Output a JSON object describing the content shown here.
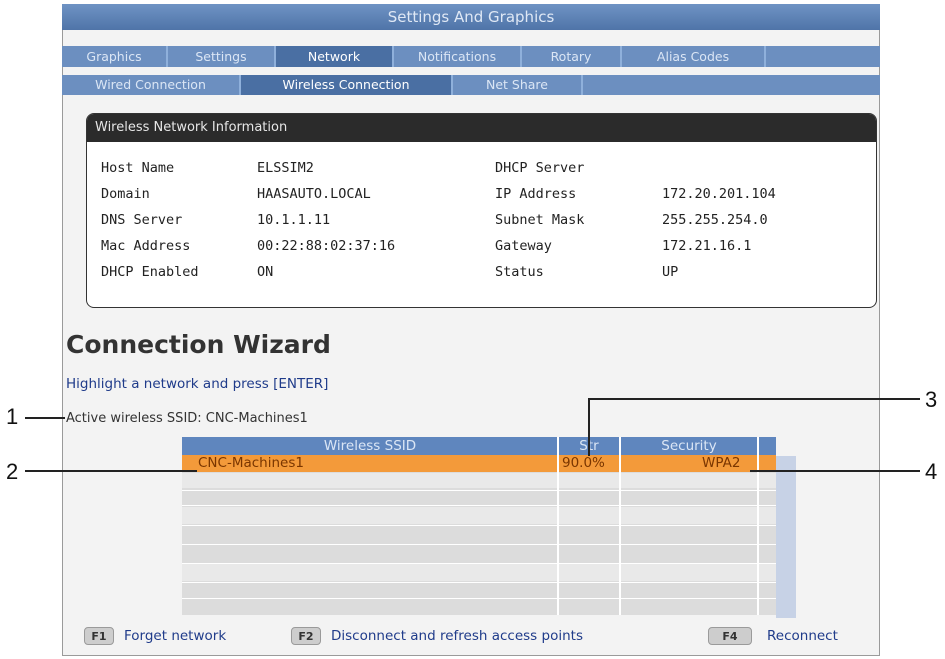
{
  "window": {
    "title": "Settings And Graphics"
  },
  "tabs_primary": [
    {
      "label": "Graphics"
    },
    {
      "label": "Settings"
    },
    {
      "label": "Network",
      "active": true
    },
    {
      "label": "Notifications"
    },
    {
      "label": "Rotary"
    },
    {
      "label": "Alias Codes"
    }
  ],
  "tabs_secondary": [
    {
      "label": "Wired Connection"
    },
    {
      "label": "Wireless Connection",
      "active": true
    },
    {
      "label": "Net Share"
    }
  ],
  "info_panel": {
    "title": "Wireless Network Information",
    "left": [
      {
        "label": "Host Name",
        "value": "ELSSIM2"
      },
      {
        "label": "Domain",
        "value": "HAASAUTO.LOCAL"
      },
      {
        "label": "DNS Server",
        "value": "10.1.1.11"
      },
      {
        "label": "Mac Address",
        "value": "00:22:88:02:37:16"
      },
      {
        "label": "DHCP Enabled",
        "value": "ON"
      }
    ],
    "right": [
      {
        "label": "DHCP Server",
        "value": ""
      },
      {
        "label": "IP Address",
        "value": "172.20.201.104"
      },
      {
        "label": "Subnet Mask",
        "value": "255.255.254.0"
      },
      {
        "label": "Gateway",
        "value": "172.21.16.1"
      },
      {
        "label": "Status",
        "value": "UP"
      }
    ]
  },
  "wizard": {
    "title": "Connection Wizard",
    "hint": "Highlight a network and press [ENTER]",
    "active_ssid": "Active wireless SSID: CNC-Machines1"
  },
  "network_table": {
    "columns": [
      "Wireless SSID",
      "Str",
      "Security"
    ],
    "rows": [
      {
        "ssid": "CNC-Machines1",
        "strength": "90.0%",
        "security": "WPA2",
        "selected": true
      }
    ]
  },
  "footer": {
    "keys": [
      {
        "key": "F1",
        "label": "Forget network"
      },
      {
        "key": "F2",
        "label": "Disconnect and refresh access points"
      },
      {
        "key": "F4",
        "label": "Reconnect"
      }
    ]
  },
  "callouts": [
    "1",
    "2",
    "3",
    "4"
  ],
  "colors": {
    "tab_blue": "#6c8fc0",
    "selected_row": "#f39a3a",
    "hint_text": "#1f3b8a"
  }
}
